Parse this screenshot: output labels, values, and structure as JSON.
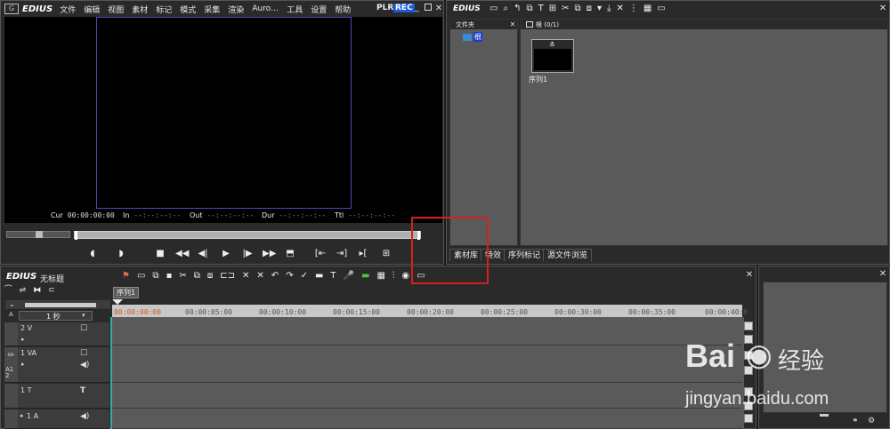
{
  "colors": {
    "bg": "#1a1a1a",
    "panel": "#2b2b2b",
    "bin": "#5a5a5a",
    "highlight_box": "#d42020",
    "rec_badge": "#1c5bd6",
    "timeline_track": "#5a5a5a",
    "ruler": "#c8c8c8"
  },
  "menubar": {
    "app_name": "EDIUS",
    "items": [
      "文件",
      "编辑",
      "视图",
      "素材",
      "标记",
      "模式",
      "采集",
      "渲染",
      "Auro…",
      "工具",
      "设置",
      "帮助"
    ],
    "plr": "PLR",
    "rec": "REC"
  },
  "preview": {
    "cur_label": "Cur",
    "cur_value": "00:00:00:00",
    "in_label": "In",
    "in_value": "--:--:--:--",
    "out_label": "Out",
    "out_value": "--:--:--:--",
    "dur_label": "Dur",
    "dur_value": "--:--:--:--",
    "ttl_label": "Ttl",
    "ttl_value": "--:--:--:--"
  },
  "bin": {
    "title": "EDIUS",
    "folder_panel_title": "文件夹",
    "folder_root": "根",
    "content_header": "根 (0/1)",
    "clip_name": "序列1",
    "tabs": [
      "素材库",
      "特效",
      "序列标记",
      "源文件浏览"
    ]
  },
  "timeline": {
    "logo": "EDIUS",
    "project_title": "无标题",
    "sequence_tab": "序列1",
    "scale_label": "1 秒",
    "ruler": [
      "00:00:00:00",
      "00:00:05:00",
      "00:00:10:00",
      "00:00:15:00",
      "00:00:20:00",
      "00:00:25:00",
      "00:00:30:00",
      "00:00:35:00",
      "00:00:40:0"
    ],
    "tracks": [
      {
        "name": "2 V",
        "side": ""
      },
      {
        "name": "1 VA",
        "side": "A1 2"
      },
      {
        "name": "1 T",
        "side": ""
      },
      {
        "name": "1 A",
        "side": ""
      }
    ]
  },
  "watermark": {
    "brand": "Bai",
    "brand2": "经验",
    "url": "jingyan.baidu.com"
  }
}
